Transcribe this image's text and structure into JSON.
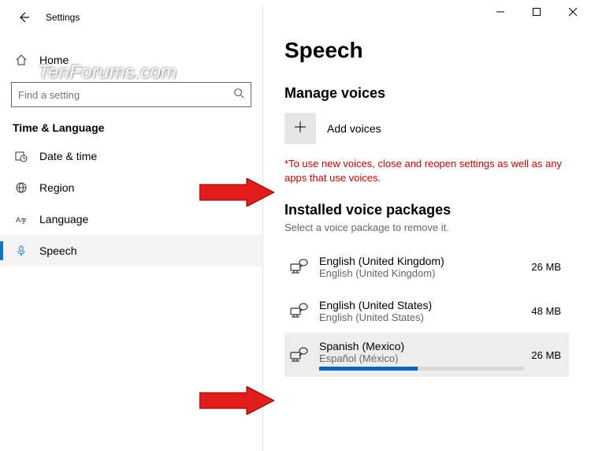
{
  "window": {
    "title": "Settings"
  },
  "sidebar": {
    "home": "Home",
    "search_placeholder": "Find a setting",
    "category": "Time & Language",
    "items": [
      {
        "label": "Date & time"
      },
      {
        "label": "Region"
      },
      {
        "label": "Language"
      },
      {
        "label": "Speech"
      }
    ]
  },
  "page": {
    "title": "Speech",
    "manage_section": "Manage voices",
    "add_label": "Add voices",
    "warning": "*To use new voices, close and reopen settings as well as any apps that use voices.",
    "installed_section": "Installed voice packages",
    "installed_hint": "Select a voice package to remove it.",
    "packages": [
      {
        "title": "English (United Kingdom)",
        "sub": "English (United Kingdom)",
        "size": "26 MB",
        "progress": null
      },
      {
        "title": "English (United States)",
        "sub": "English (United States)",
        "size": "48 MB",
        "progress": null
      },
      {
        "title": "Spanish (Mexico)",
        "sub": "Español (México)",
        "size": "26 MB",
        "progress": 48
      }
    ]
  },
  "watermark": "TenForums.com"
}
